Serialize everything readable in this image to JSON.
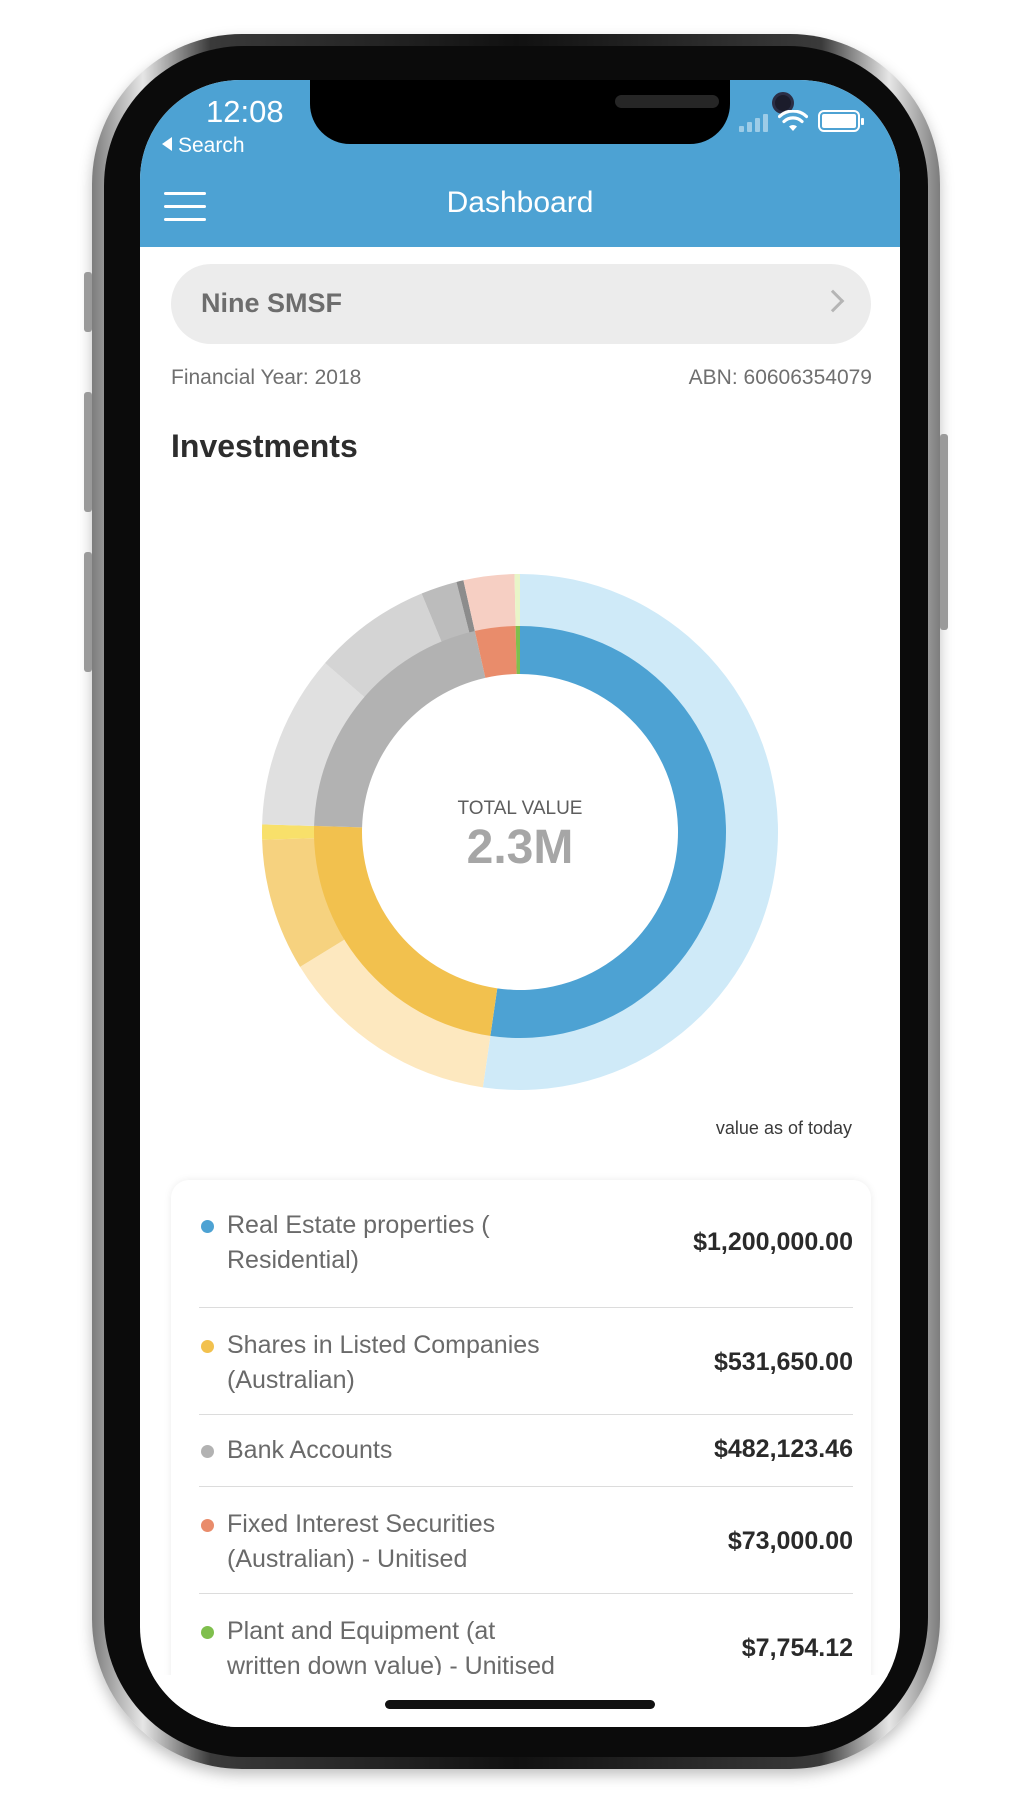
{
  "status_bar": {
    "time": "12:08",
    "back_label": "Search"
  },
  "header": {
    "title": "Dashboard"
  },
  "fund": {
    "name": "Nine SMSF"
  },
  "meta": {
    "financial_year": "Financial Year: 2018",
    "abn": "ABN: 60606354079"
  },
  "section": {
    "title": "Investments"
  },
  "chart": {
    "center_label": "TOTAL VALUE",
    "center_value": "2.3M",
    "as_of": "value as of today"
  },
  "chart_data": {
    "type": "pie",
    "variant": "nested-donut",
    "title": "",
    "inner_ring": [
      {
        "name": "Real Estate properties ( Residential)",
        "value": 1200000,
        "color": "#4da2d3"
      },
      {
        "name": "Shares in Listed Companies (Australian)",
        "value": 531650,
        "color": "#f2c14e"
      },
      {
        "name": "Bank Accounts",
        "value": 482123.46,
        "color": "#b2b2b2"
      },
      {
        "name": "Fixed Interest Securities (Australian) - Unitised",
        "value": 73000,
        "color": "#e98c6b"
      },
      {
        "name": "Plant and Equipment (at written down value) - Unitised",
        "value": 7754.12,
        "color": "#7fbf4d"
      }
    ],
    "outer_ring": [
      {
        "value": 1200000,
        "color": "#cfeaf8"
      },
      {
        "value": 320000,
        "color": "#fde8bf"
      },
      {
        "value": 190000,
        "color": "#f6d27f"
      },
      {
        "value": 21650,
        "color": "#f8e06a"
      },
      {
        "value": 250000,
        "color": "#e0e0e0"
      },
      {
        "value": 170000,
        "color": "#d4d4d4"
      },
      {
        "value": 52000,
        "color": "#bcbcbc"
      },
      {
        "value": 10123.46,
        "color": "#8c8c8c"
      },
      {
        "value": 73000,
        "color": "#f6cfc3"
      },
      {
        "value": 7754.12,
        "color": "#e8f5c8"
      }
    ]
  },
  "investments": [
    {
      "label": "Real Estate properties ( Residential)",
      "value": "$1,200,000.00",
      "color": "#4da2d3"
    },
    {
      "label": "Shares in Listed Companies (Australian)",
      "value": "$531,650.00",
      "color": "#f2c14e"
    },
    {
      "label": "Bank Accounts",
      "value": "$482,123.46",
      "color": "#b2b2b2"
    },
    {
      "label": "Fixed Interest Securities (Australian) - Unitised",
      "value": "$73,000.00",
      "color": "#e98c6b"
    },
    {
      "label": "Plant and Equipment (at written down value) - Unitised",
      "value": "$7,754.12",
      "color": "#7fbf4d"
    }
  ]
}
